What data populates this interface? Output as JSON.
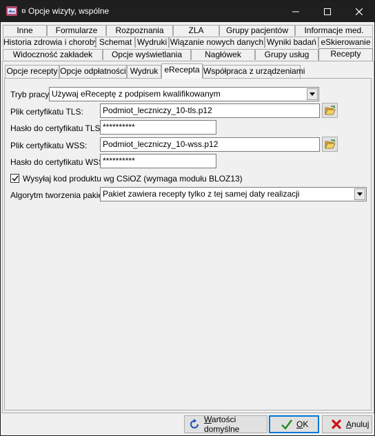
{
  "window": {
    "title": "¤ Opcje wizyty, wspólne"
  },
  "tabs": {
    "row1": [
      "Inne",
      "Formularze",
      "Rozpoznania",
      "ZLA",
      "Grupy pacjentów",
      "Informacje med."
    ],
    "row2": [
      "Historia zdrowia i choroby",
      "Schemat",
      "Wydruki",
      "Wiązanie nowych danych",
      "Wyniki badań",
      "eSkierowanie"
    ],
    "row3": [
      "Widoczność zakładek",
      "Opcje wyświetlania",
      "Nagłówek",
      "Grupy usług",
      "Recepty"
    ]
  },
  "subtabs": [
    "Opcje recepty",
    "Opcje odpłatności",
    "Wydruk",
    "eRecepta",
    "Współpraca z urządzeniami"
  ],
  "form": {
    "mode_label": "Tryb pracy:",
    "mode_value": "Używaj eReceptę z podpisem kwalifikowanym",
    "tls_file_label": "Plik certyfikatu TLS:",
    "tls_file_value": "Podmiot_leczniczy_10-tls.p12",
    "tls_pass_label": "Hasło do certyfikatu TLS:",
    "tls_pass_value": "**********",
    "wss_file_label": "Plik certyfikatu WSS:",
    "wss_file_value": "Podmiot_leczniczy_10-wss.p12",
    "wss_pass_label": "Hasło do certyfikatu WSS:",
    "wss_pass_value": "**********",
    "csioz_label": "Wysyłaj kod produktu wg CSiOZ (wymaga modułu BLOZ13)",
    "csioz_checked": true,
    "algo_label": "Algorytm tworzenia pakietu:",
    "algo_value": "Pakiet zawiera recepty tylko z tej samej daty realizacji"
  },
  "buttons": {
    "defaults_u": "W",
    "defaults_rest": "artości domyślne",
    "ok_u": "O",
    "ok_rest": "K",
    "cancel_u": "A",
    "cancel_rest": "nuluj"
  },
  "colors": {
    "titlebar": "#1f1f1f",
    "accent": "#0078d7",
    "check": "#2e8b2e",
    "cancel": "#cc1010"
  }
}
